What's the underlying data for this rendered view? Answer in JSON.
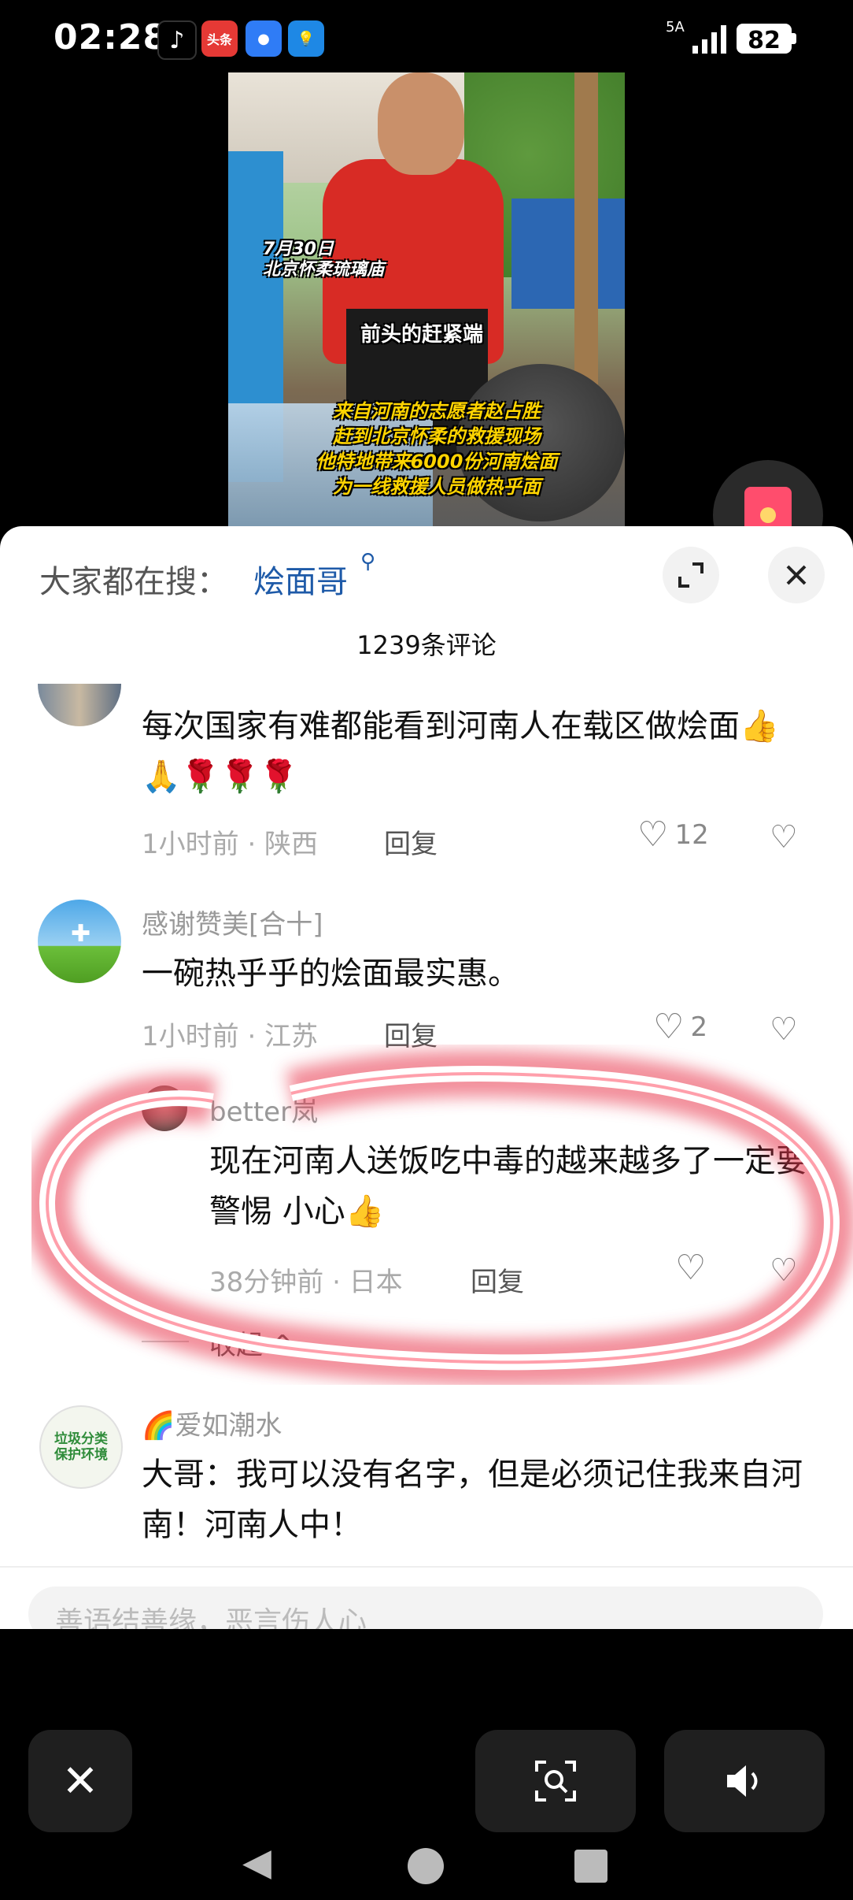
{
  "status_bar": {
    "time": "02:28",
    "apps": [
      "tiktok-icon",
      "toutiao-icon",
      "messages-icon",
      "bulb-icon"
    ],
    "toutiao_label": "头条",
    "network": "5A",
    "battery": "82"
  },
  "video": {
    "caption_date": "7月30日\n北京怀柔琉璃庙",
    "caption_mid": "前头的赶紧端",
    "caption_main": "来自河南的志愿者赵占胜\n赶到北京怀柔的救援现场\n他特地带来6000份河南烩面\n为一线救援人员做热乎面"
  },
  "sheet": {
    "search_hint": "大家都在搜：",
    "search_term": "烩面哥",
    "comment_count": "1239条评论"
  },
  "comments": [
    {
      "text": "每次国家有难都能看到河南人在载区做烩面👍🙏🌹🌹🌹",
      "meta": "1小时前 · 陕西",
      "reply": "回复",
      "likes": "12"
    },
    {
      "username": "感谢赞美[合十]",
      "text": "一碗热乎乎的烩面最实惠。",
      "meta": "1小时前 · 江苏",
      "reply": "回复",
      "likes": "2"
    },
    {
      "username": "better岚",
      "text": "现在河南人送饭吃中毒的越来越多了一定要警惕 小心👍",
      "meta": "38分钟前 · 日本",
      "reply": "回复",
      "likes": ""
    },
    {
      "username": "🌈爱如潮水",
      "text": "大哥：我可以没有名字，但是必须记住我来自河南！河南人中！"
    }
  ],
  "collapse_label": "收起 ^",
  "input": {
    "placeholder": "善语结善缘，恶言伤人心"
  },
  "avatar_trash_text": [
    "垃圾分类",
    "保护环境"
  ],
  "controls": {
    "close": "✕",
    "lens": "⌕",
    "sound": "🔊"
  },
  "colors": {
    "link_blue": "#1e5aa8",
    "highlight_red": "#e8344c"
  }
}
